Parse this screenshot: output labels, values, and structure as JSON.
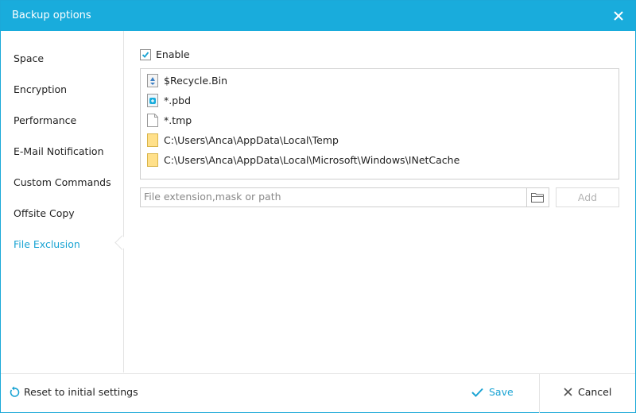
{
  "window": {
    "title": "Backup options"
  },
  "sidebar": {
    "items": [
      {
        "label": "Space"
      },
      {
        "label": "Encryption"
      },
      {
        "label": "Performance"
      },
      {
        "label": "E-Mail Notification"
      },
      {
        "label": "Custom Commands"
      },
      {
        "label": "Offsite Copy"
      },
      {
        "label": "File Exclusion",
        "active": true
      }
    ]
  },
  "exclusion": {
    "enable_label": "Enable",
    "enabled": true,
    "items": [
      {
        "text": "$Recycle.Bin",
        "icon": "recycle-bin-icon"
      },
      {
        "text": "*.pbd",
        "icon": "pbd-file-icon"
      },
      {
        "text": "*.tmp",
        "icon": "blank-file-icon"
      },
      {
        "text": "C:\\Users\\Anca\\AppData\\Local\\Temp",
        "icon": "folder-icon"
      },
      {
        "text": "C:\\Users\\Anca\\AppData\\Local\\Microsoft\\Windows\\INetCache",
        "icon": "folder-icon"
      }
    ],
    "input_value": "",
    "input_placeholder": "File extension,mask or path",
    "add_label": "Add"
  },
  "footer": {
    "reset_label": "Reset to initial settings",
    "save_label": "Save",
    "cancel_label": "Cancel"
  },
  "colors": {
    "accent": "#19acdc",
    "accent_text": "#19a3d3",
    "border": "#cfcfcf",
    "disabled": "#b3b3b3"
  }
}
